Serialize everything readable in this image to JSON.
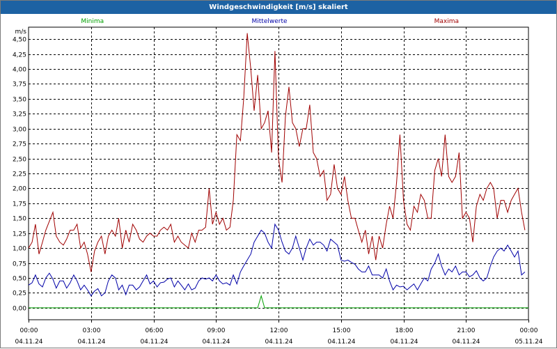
{
  "window": {
    "title": "Windgeschwindigkeit [m/s] skaliert"
  },
  "colors": {
    "titlebar": "#1d62a3",
    "minima": "#00a000",
    "mittelwerte": "#0000a8",
    "maxima": "#a00000",
    "grid": "#000000"
  },
  "chart_data": {
    "type": "line",
    "title": "Windgeschwindigkeit [m/s] skaliert",
    "ylabel": "m/s",
    "xlabel": "",
    "ylim": [
      -0.2,
      4.7
    ],
    "xlim": [
      0,
      24
    ],
    "grid": true,
    "legend": "top",
    "y_ticks": [
      "4,50",
      "4,25",
      "4,00",
      "3,75",
      "3,50",
      "3,25",
      "3,00",
      "2,75",
      "2,50",
      "2,25",
      "2,00",
      "1,75",
      "1,50",
      "1,25",
      "1,00",
      "0,75",
      "0,50",
      "0,25",
      "0,00"
    ],
    "x_ticks": [
      {
        "time": "00:00",
        "date": "04.11.24"
      },
      {
        "time": "03:00",
        "date": "04.11.24"
      },
      {
        "time": "06:00",
        "date": "04.11.24"
      },
      {
        "time": "09:00",
        "date": "04.11.24"
      },
      {
        "time": "12:00",
        "date": "04.11.24"
      },
      {
        "time": "15:00",
        "date": "04.11.24"
      },
      {
        "time": "18:00",
        "date": "04.11.24"
      },
      {
        "time": "21:00",
        "date": "04.11.24"
      },
      {
        "time": "00:00",
        "date": "05.11.24"
      }
    ],
    "x_hours": [
      0,
      0.17,
      0.33,
      0.5,
      0.67,
      0.83,
      1,
      1.17,
      1.33,
      1.5,
      1.67,
      1.83,
      2,
      2.17,
      2.33,
      2.5,
      2.67,
      2.83,
      3,
      3.17,
      3.33,
      3.5,
      3.67,
      3.83,
      4,
      4.17,
      4.33,
      4.5,
      4.67,
      4.83,
      5,
      5.17,
      5.33,
      5.5,
      5.67,
      5.83,
      6,
      6.17,
      6.33,
      6.5,
      6.67,
      6.83,
      7,
      7.17,
      7.33,
      7.5,
      7.67,
      7.83,
      8,
      8.17,
      8.33,
      8.5,
      8.67,
      8.83,
      9,
      9.17,
      9.33,
      9.5,
      9.67,
      9.83,
      10,
      10.17,
      10.33,
      10.5,
      10.67,
      10.83,
      11,
      11.17,
      11.33,
      11.5,
      11.67,
      11.83,
      12,
      12.17,
      12.33,
      12.5,
      12.67,
      12.83,
      13,
      13.17,
      13.33,
      13.5,
      13.67,
      13.83,
      14,
      14.17,
      14.33,
      14.5,
      14.67,
      14.83,
      15,
      15.17,
      15.33,
      15.5,
      15.67,
      15.83,
      16,
      16.17,
      16.33,
      16.5,
      16.67,
      16.83,
      17,
      17.17,
      17.33,
      17.5,
      17.67,
      17.83,
      18,
      18.17,
      18.33,
      18.5,
      18.67,
      18.83,
      19,
      19.17,
      19.33,
      19.5,
      19.67,
      19.83,
      20,
      20.17,
      20.33,
      20.5,
      20.67,
      20.83,
      21,
      21.17,
      21.33,
      21.5,
      21.67,
      21.83,
      22,
      22.17,
      22.33,
      22.5,
      22.67,
      22.83,
      23,
      23.17,
      23.33,
      23.5,
      23.67,
      23.83,
      24
    ],
    "series": [
      {
        "name": "Minima",
        "color": "#00a000",
        "values": [
          0,
          0,
          0,
          0,
          0,
          0,
          0,
          0,
          0,
          0,
          0,
          0,
          0,
          0,
          0,
          0,
          0,
          0,
          0,
          0,
          0,
          0,
          0,
          0,
          0,
          0,
          0,
          0,
          0,
          0,
          0,
          0,
          0,
          0,
          0,
          0,
          0,
          0,
          0,
          0,
          0,
          0,
          0,
          0,
          0,
          0,
          0,
          0,
          0,
          0,
          0,
          0,
          0,
          0,
          0,
          0,
          0,
          0,
          0,
          0,
          0,
          0,
          0,
          0,
          0,
          0,
          0,
          0.2,
          0,
          0,
          0,
          0,
          0,
          0,
          0,
          0,
          0,
          0,
          0,
          0,
          0,
          0,
          0,
          0,
          0,
          0,
          0,
          0,
          0,
          0,
          0,
          0,
          0,
          0,
          0,
          0,
          0,
          0,
          0,
          0,
          0,
          0,
          0,
          0,
          0,
          0,
          0,
          0,
          0,
          0,
          0,
          0,
          0,
          0,
          0,
          0,
          0,
          0,
          0,
          0,
          0,
          0,
          0,
          0,
          0,
          0,
          0,
          0,
          0,
          0,
          0,
          0,
          0,
          0,
          0,
          0,
          0,
          0,
          0,
          0,
          0,
          0,
          0,
          0,
          0
        ]
      },
      {
        "name": "Mittelwerte",
        "color": "#0000a8",
        "values": [
          0.38,
          0.42,
          0.55,
          0.4,
          0.35,
          0.5,
          0.58,
          0.48,
          0.33,
          0.45,
          0.45,
          0.33,
          0.42,
          0.55,
          0.45,
          0.3,
          0.38,
          0.3,
          0.2,
          0.28,
          0.32,
          0.2,
          0.25,
          0.45,
          0.55,
          0.5,
          0.3,
          0.38,
          0.22,
          0.38,
          0.38,
          0.3,
          0.35,
          0.45,
          0.55,
          0.4,
          0.45,
          0.35,
          0.42,
          0.43,
          0.48,
          0.5,
          0.35,
          0.45,
          0.38,
          0.3,
          0.4,
          0.3,
          0.33,
          0.45,
          0.5,
          0.48,
          0.5,
          0.45,
          0.55,
          0.45,
          0.4,
          0.42,
          0.38,
          0.55,
          0.4,
          0.6,
          0.7,
          0.8,
          0.9,
          1.1,
          1.2,
          1.3,
          1.25,
          1.1,
          1.0,
          1.4,
          1.3,
          1.1,
          0.95,
          0.9,
          1.0,
          1.2,
          1.0,
          0.8,
          1.0,
          1.15,
          1.05,
          1.1,
          1.1,
          1.05,
          0.95,
          1.15,
          1.1,
          1.05,
          0.8,
          0.78,
          0.8,
          0.76,
          0.73,
          0.65,
          0.6,
          0.6,
          0.7,
          0.55,
          0.55,
          0.55,
          0.5,
          0.65,
          0.45,
          0.3,
          0.38,
          0.35,
          0.36,
          0.3,
          0.35,
          0.4,
          0.3,
          0.4,
          0.5,
          0.45,
          0.65,
          0.75,
          0.9,
          0.7,
          0.55,
          0.65,
          0.6,
          0.7,
          0.55,
          0.6,
          0.6,
          0.52,
          0.55,
          0.62,
          0.5,
          0.45,
          0.5,
          0.7,
          0.85,
          0.95,
          1.0,
          0.95,
          1.05,
          0.95,
          0.85,
          0.95,
          0.55,
          0.6
        ]
      },
      {
        "name": "Maxima",
        "color": "#a00000",
        "values": [
          1.0,
          1.1,
          1.4,
          0.9,
          1.1,
          1.3,
          1.45,
          1.6,
          1.2,
          1.1,
          1.05,
          1.15,
          1.3,
          1.3,
          1.4,
          1.0,
          1.1,
          0.9,
          0.6,
          0.95,
          1.1,
          1.2,
          0.9,
          1.2,
          1.3,
          1.2,
          1.5,
          1.0,
          1.3,
          1.1,
          1.4,
          1.3,
          1.15,
          1.1,
          1.2,
          1.25,
          1.2,
          1.2,
          1.3,
          1.35,
          1.3,
          1.4,
          1.1,
          1.2,
          1.1,
          1.05,
          1.0,
          1.25,
          1.1,
          1.3,
          1.3,
          1.35,
          2.0,
          1.4,
          1.6,
          1.4,
          1.5,
          1.3,
          1.35,
          1.8,
          2.9,
          2.8,
          3.5,
          4.6,
          4.0,
          3.3,
          3.9,
          3.0,
          3.1,
          3.3,
          2.6,
          4.3,
          2.5,
          2.1,
          3.2,
          3.7,
          3.1,
          3.0,
          2.7,
          3.0,
          3.0,
          3.4,
          2.6,
          2.5,
          2.2,
          2.3,
          1.8,
          1.9,
          2.4,
          2.0,
          1.9,
          2.2,
          1.8,
          1.5,
          1.5,
          1.3,
          1.1,
          1.3,
          0.9,
          1.2,
          0.8,
          1.2,
          1.0,
          1.4,
          1.7,
          1.5,
          2.1,
          2.9,
          1.8,
          1.4,
          1.3,
          1.7,
          1.6,
          1.9,
          1.8,
          1.5,
          1.5,
          2.3,
          2.5,
          2.2,
          2.9,
          2.2,
          2.1,
          2.2,
          2.6,
          1.5,
          1.6,
          1.5,
          1.1,
          1.7,
          1.9,
          1.8,
          2.0,
          2.1,
          2.0,
          1.5,
          1.8,
          1.8,
          1.6,
          1.8,
          1.9,
          2.0,
          1.6,
          1.3
        ]
      }
    ]
  }
}
